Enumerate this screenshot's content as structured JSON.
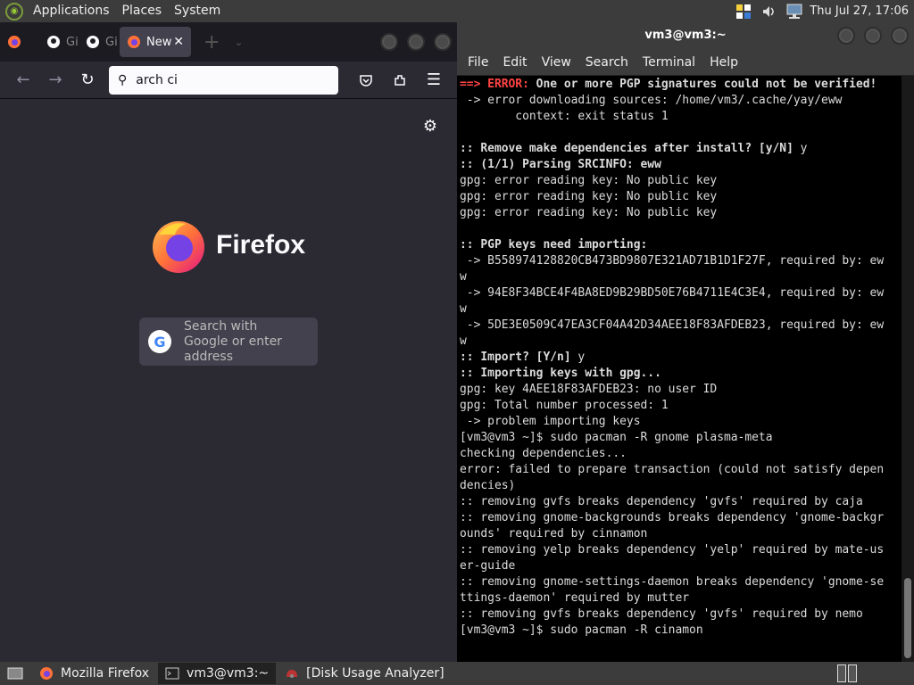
{
  "top_panel": {
    "menus": [
      "Applications",
      "Places",
      "System"
    ],
    "clock": "Thu Jul 27, 17:06",
    "icons": [
      "distro-logo-icon",
      "keyboard-layout-icon",
      "volume-icon",
      "network-icon"
    ]
  },
  "firefox": {
    "tabs": [
      {
        "label": "",
        "icon": "firefox-icon"
      },
      {
        "label": "GitH",
        "icon": "github-icon"
      },
      {
        "label": "GitH",
        "icon": "github-icon"
      },
      {
        "label": "New",
        "icon": "firefox-icon",
        "active": true
      }
    ],
    "url_value": "arch ci",
    "logo_text": "Firefox",
    "search_card_text": "Search with Google or enter address"
  },
  "terminal": {
    "title": "vm3@vm3:~",
    "menu": [
      "File",
      "Edit",
      "View",
      "Search",
      "Terminal",
      "Help"
    ],
    "lines": [
      {
        "t": "==> ",
        "cls": "red",
        "rest": "ERROR:",
        "rest_cls": "red",
        "tail": " One or more PGP signatures could not be verified!",
        "tail_cls": "b"
      },
      {
        "t": " -> error downloading sources: /home/vm3/.cache/yay/eww"
      },
      {
        "t": "        context: exit status 1"
      },
      {
        "t": ""
      },
      {
        "t": ":: Remove make dependencies after install? [y/N]",
        "cls": "b",
        "tail": " y"
      },
      {
        "t": ":: (1/1) Parsing SRCINFO: eww",
        "cls": "b"
      },
      {
        "t": "gpg: error reading key: No public key"
      },
      {
        "t": "gpg: error reading key: No public key"
      },
      {
        "t": "gpg: error reading key: No public key"
      },
      {
        "t": ""
      },
      {
        "t": ":: PGP keys need importing:",
        "cls": "b"
      },
      {
        "t": " -> B558974128820CB473BD9807E321AD71B1D1F27F, required by: ew"
      },
      {
        "t": "w"
      },
      {
        "t": " -> 94E8F34BCE4F4BA8ED9B29BD50E76B4711E4C3E4, required by: ew"
      },
      {
        "t": "w"
      },
      {
        "t": " -> 5DE3E0509C47EA3CF04A42D34AEE18F83AFDEB23, required by: ew"
      },
      {
        "t": "w"
      },
      {
        "t": ":: Import? [Y/n]",
        "cls": "b",
        "tail": " y"
      },
      {
        "t": ":: Importing keys with gpg...",
        "cls": "b"
      },
      {
        "t": "gpg: key 4AEE18F83AFDEB23: no user ID"
      },
      {
        "t": "gpg: Total number processed: 1"
      },
      {
        "t": " -> problem importing keys"
      },
      {
        "t": "[vm3@vm3 ~]$ sudo pacman -R gnome plasma-meta"
      },
      {
        "t": "checking dependencies..."
      },
      {
        "t": "error: failed to prepare transaction (could not satisfy depen"
      },
      {
        "t": "dencies)"
      },
      {
        "t": ":: removing gvfs breaks dependency 'gvfs' required by caja"
      },
      {
        "t": ":: removing gnome-backgrounds breaks dependency 'gnome-backgr"
      },
      {
        "t": "ounds' required by cinnamon"
      },
      {
        "t": ":: removing yelp breaks dependency 'yelp' required by mate-us"
      },
      {
        "t": "er-guide"
      },
      {
        "t": ":: removing gnome-settings-daemon breaks dependency 'gnome-se"
      },
      {
        "t": "ttings-daemon' required by mutter"
      },
      {
        "t": ":: removing gvfs breaks dependency 'gvfs' required by nemo"
      },
      {
        "t": "[vm3@vm3 ~]$ sudo pacman -R cinamon"
      }
    ]
  },
  "bottom_panel": {
    "tasks": [
      {
        "label": "Mozilla Firefox",
        "icon": "firefox-icon"
      },
      {
        "label": "vm3@vm3:~",
        "icon": "terminal-icon",
        "active": true
      },
      {
        "label": "[Disk Usage Analyzer]",
        "icon": "disk-usage-icon"
      }
    ]
  }
}
